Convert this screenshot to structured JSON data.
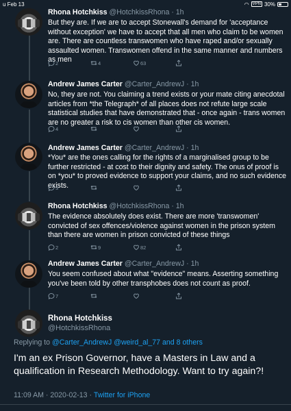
{
  "status_bar": {
    "time": "u Feb 13",
    "vpn": "VPN",
    "battery": "30%"
  },
  "tweets": [
    {
      "name": "Rhona Hotchkiss",
      "handle": "@HotchkissRhona · 1h",
      "text": "But they are. If we are to accept Stonewall's demand for 'acceptance without exception' we have to accept that all men who claim to be women are. There are countless transwomen who have raped and/or sexually assaulted women. Transwomen offend in the same manner and numbers as men",
      "replies": "2",
      "retweets": "4",
      "likes": "63"
    },
    {
      "name": "Andrew James Carter",
      "handle": "@Carter_AndrewJ · 1h",
      "text": "No, they are not. You claiming a trend exists or your mate citing anecdotal articles from *the Telegraph* of all places does not refute large scale statistical studies that have demonstrated that - once again - trans women are no greater a risk to cis women than other cis women.",
      "replies": "4",
      "retweets": "",
      "likes": ""
    },
    {
      "name": "Andrew James Carter",
      "handle": "@Carter_AndrewJ · 1h",
      "text": "*You* are the ones calling for the rights of a marginalised group to be further restricted - at cost to their dignity and safety. The onus of proof is on *you* to proved evidence to support your claims, and no such evidence exists.",
      "replies": "3",
      "retweets": "",
      "likes": ""
    },
    {
      "name": "Rhona Hotchkiss",
      "handle": "@HotchkissRhona · 1h",
      "text": "The evidence absolutely does exist. There are more 'transwomen' convicted of sex offences/violence against women in the prison system than there are women in prison convicted of these things",
      "replies": "2",
      "retweets": "9",
      "likes": "82"
    },
    {
      "name": "Andrew James Carter",
      "handle": "@Carter_AndrewJ · 1h",
      "text": "You seem confused about what \"evidence\" means. Asserting something you've been told by other transphobes does not count as proof.",
      "replies": "7",
      "retweets": "",
      "likes": ""
    }
  ],
  "main_tweet": {
    "name": "Rhona Hotchkiss",
    "handle": "@HotchkissRhona",
    "reply_prefix": "Replying to ",
    "mentions": "@Carter_AndrewJ @weird_al_77 and 8 others",
    "text": "I'm an ex Prison Governor, have a Masters in Law and a qualification in Research Methodology. Want to try again?!",
    "timestamp": "11:09 AM · 2020-02-13 · ",
    "source": "Twitter for iPhone"
  },
  "icons": [
    "reply-icon",
    "retweet-icon",
    "like-icon",
    "share-icon",
    "wifi-icon",
    "battery-icon"
  ]
}
